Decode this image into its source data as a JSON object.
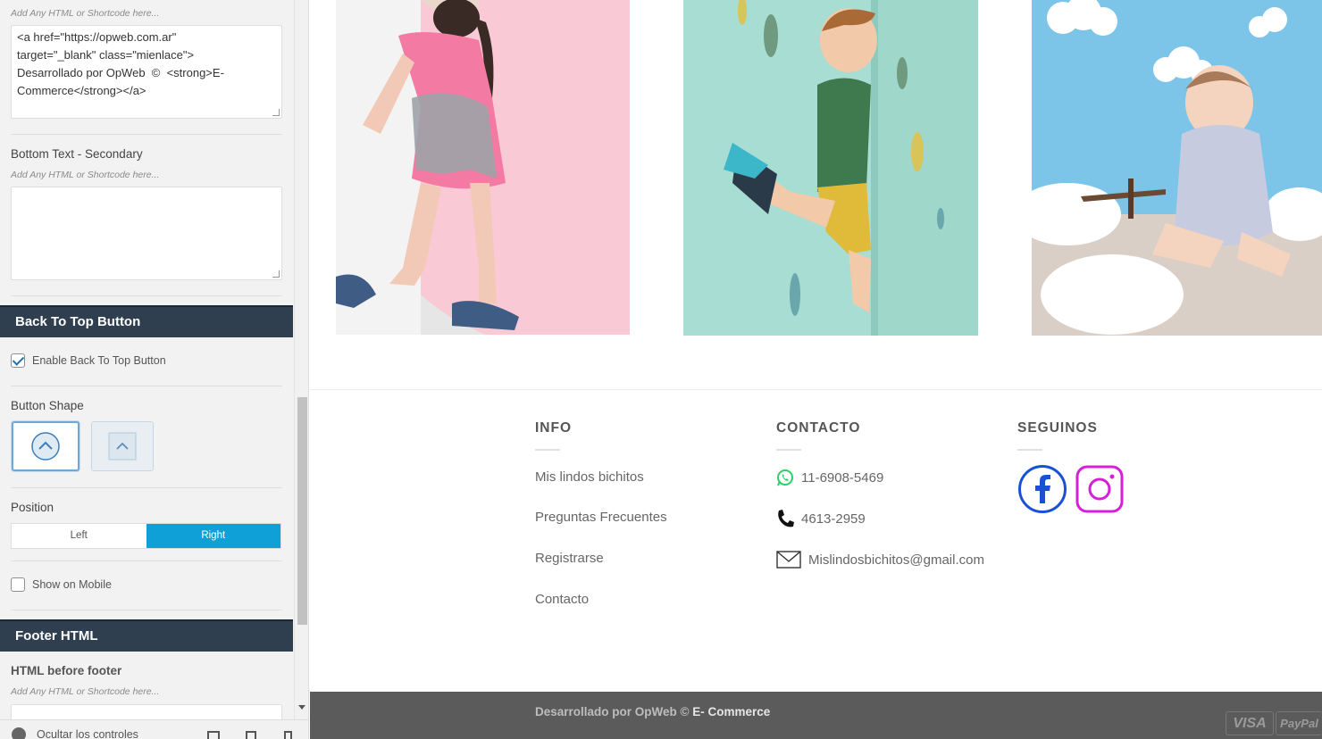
{
  "sidebar": {
    "help_top": "Add Any HTML or Shortcode here...",
    "bottom_primary_code": "<a href=\"https://opweb.com.ar\"\ntarget=\"_blank\" class=\"mienlace\">\nDesarrollado por OpWeb  ©  <strong>E-\nCommerce</strong></a>",
    "bottom_secondary_label": "Bottom Text - Secondary",
    "help_secondary": "Add Any HTML or Shortcode here...",
    "bottom_secondary_value": "",
    "back_to_top_heading": "Back To Top Button",
    "enable_back_to_top": "Enable Back To Top Button",
    "button_shape_label": "Button Shape",
    "position_label": "Position",
    "position_left": "Left",
    "position_right": "Right",
    "show_on_mobile": "Show on Mobile",
    "footer_html_heading": "Footer HTML",
    "html_before_footer_label": "HTML before footer",
    "help_before_footer": "Add Any HTML or Shortcode here...",
    "hide_controls": "Ocultar los controles"
  },
  "footer": {
    "info_title": "INFO",
    "info_links": [
      "Mis lindos bichitos",
      "Preguntas Frecuentes",
      "Registrarse",
      "Contacto"
    ],
    "contact_title": "CONTACTO",
    "whatsapp": "11-6908-5469",
    "phone": "4613-2959",
    "email": "Mislindosbichitos@gmail.com",
    "social_title": "SEGUINOS",
    "copyright_prefix": "Desarrollado por OpWeb © ",
    "copyright_brand": "E- Commerce",
    "pay_visa": "VISA",
    "pay_paypal": "PayPal"
  },
  "colors": {
    "section_header": "#2f3f4f",
    "accent": "#0ea0d6",
    "whatsapp": "#25d366",
    "facebook": "#1a4fd8",
    "instagram": "#d81ed8"
  }
}
